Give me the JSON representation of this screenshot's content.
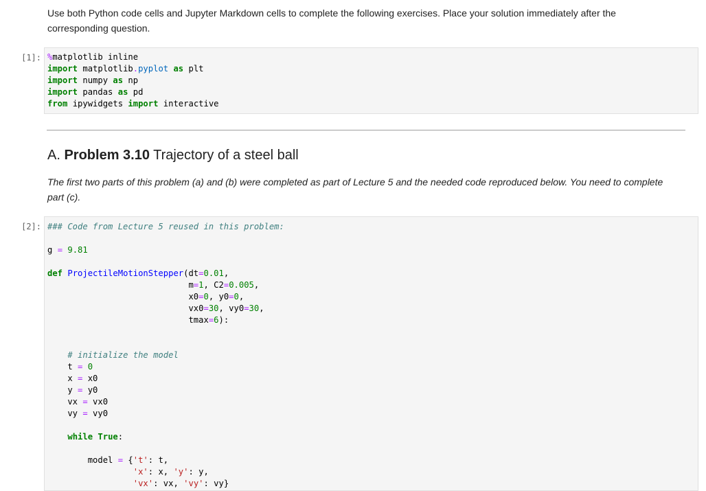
{
  "intro_text": "Use both Python code cells and Jupyter Markdown cells to complete the following exercises. Place your solution immediately after the corresponding question.",
  "cell1": {
    "prompt": "[1]:",
    "lines": [
      [
        [
          "mag",
          "%"
        ],
        [
          "",
          "matplotlib inline"
        ]
      ],
      [
        [
          "kw",
          "import"
        ],
        [
          "",
          " matplotlib"
        ],
        [
          "op",
          "."
        ],
        [
          "mod",
          "pyplot"
        ],
        [
          "",
          " "
        ],
        [
          "kw",
          "as"
        ],
        [
          "",
          " plt"
        ]
      ],
      [
        [
          "kw",
          "import"
        ],
        [
          "",
          " numpy "
        ],
        [
          "kw",
          "as"
        ],
        [
          "",
          " np"
        ]
      ],
      [
        [
          "kw",
          "import"
        ],
        [
          "",
          " pandas "
        ],
        [
          "kw",
          "as"
        ],
        [
          "",
          " pd"
        ]
      ],
      [
        [
          "kw",
          "from"
        ],
        [
          "",
          " ipywidgets "
        ],
        [
          "kw",
          "import"
        ],
        [
          "",
          " interactive"
        ]
      ]
    ]
  },
  "section_heading": {
    "prefix": "A. ",
    "bold": "Problem 3.10",
    "rest": " Trajectory of a steel ball"
  },
  "problem_text": "The first two parts of this problem (a) and (b) were completed as part of Lecture 5 and the needed code reproduced below. You need to complete part (c).",
  "cell2": {
    "prompt": "[2]:",
    "lines": [
      [
        [
          "cm",
          "### Code from Lecture 5 reused in this problem:"
        ]
      ],
      [],
      [
        [
          "",
          "g "
        ],
        [
          "op",
          "="
        ],
        [
          "",
          " "
        ],
        [
          "num",
          "9.81"
        ]
      ],
      [],
      [
        [
          "kw",
          "def"
        ],
        [
          "",
          " "
        ],
        [
          "fn",
          "ProjectileMotionStepper"
        ],
        [
          "",
          "(dt"
        ],
        [
          "op",
          "="
        ],
        [
          "num",
          "0.01"
        ],
        [
          "",
          ","
        ]
      ],
      [
        [
          "",
          "                            m"
        ],
        [
          "op",
          "="
        ],
        [
          "num",
          "1"
        ],
        [
          "",
          ", C2"
        ],
        [
          "op",
          "="
        ],
        [
          "num",
          "0.005"
        ],
        [
          "",
          ","
        ]
      ],
      [
        [
          "",
          "                            x0"
        ],
        [
          "op",
          "="
        ],
        [
          "num",
          "0"
        ],
        [
          "",
          ", y0"
        ],
        [
          "op",
          "="
        ],
        [
          "num",
          "0"
        ],
        [
          "",
          ","
        ]
      ],
      [
        [
          "",
          "                            vx0"
        ],
        [
          "op",
          "="
        ],
        [
          "num",
          "30"
        ],
        [
          "",
          ", vy0"
        ],
        [
          "op",
          "="
        ],
        [
          "num",
          "30"
        ],
        [
          "",
          ","
        ]
      ],
      [
        [
          "",
          "                            tmax"
        ],
        [
          "op",
          "="
        ],
        [
          "num",
          "6"
        ],
        [
          "",
          "):"
        ]
      ],
      [],
      [],
      [
        [
          "",
          "    "
        ],
        [
          "cm",
          "# initialize the model"
        ]
      ],
      [
        [
          "",
          "    t "
        ],
        [
          "op",
          "="
        ],
        [
          "",
          " "
        ],
        [
          "num",
          "0"
        ]
      ],
      [
        [
          "",
          "    x "
        ],
        [
          "op",
          "="
        ],
        [
          "",
          " x0"
        ]
      ],
      [
        [
          "",
          "    y "
        ],
        [
          "op",
          "="
        ],
        [
          "",
          " y0"
        ]
      ],
      [
        [
          "",
          "    vx "
        ],
        [
          "op",
          "="
        ],
        [
          "",
          " vx0"
        ]
      ],
      [
        [
          "",
          "    vy "
        ],
        [
          "op",
          "="
        ],
        [
          "",
          " vy0"
        ]
      ],
      [],
      [
        [
          "",
          "    "
        ],
        [
          "kw",
          "while"
        ],
        [
          "",
          " "
        ],
        [
          "kw",
          "True"
        ],
        [
          "",
          ":"
        ]
      ],
      [],
      [
        [
          "",
          "        model "
        ],
        [
          "op",
          "="
        ],
        [
          "",
          " {"
        ],
        [
          "str",
          "'t'"
        ],
        [
          "",
          ": t,"
        ]
      ],
      [
        [
          "",
          "                 "
        ],
        [
          "str",
          "'x'"
        ],
        [
          "",
          ": x, "
        ],
        [
          "str",
          "'y'"
        ],
        [
          "",
          ": y,"
        ]
      ],
      [
        [
          "",
          "                 "
        ],
        [
          "str",
          "'vx'"
        ],
        [
          "",
          ": vx, "
        ],
        [
          "str",
          "'vy'"
        ],
        [
          "",
          ": vy}"
        ]
      ]
    ]
  }
}
